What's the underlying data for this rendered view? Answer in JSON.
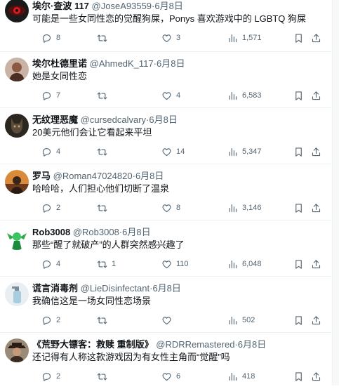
{
  "tweets": [
    {
      "name": "埃尔·查波 117",
      "handle": "@JoseA93559",
      "dot": "·",
      "time": "6月8日",
      "text": "可能是一些女同性恋的觉醒狗屎，Ponys 喜欢游戏中的 LGBTQ 狗屎",
      "replies": "8",
      "retweets": "",
      "likes": "3",
      "views": "1,571",
      "avatar": "red-eye-avatar"
    },
    {
      "name": "埃尔杜德里诺",
      "handle": "@AhmedK_117",
      "dot": "·",
      "time": "6月8日",
      "text": "她是女同性恋",
      "replies": "7",
      "retweets": "",
      "likes": "4",
      "views": "6,583",
      "avatar": "portrait-avatar"
    },
    {
      "name": "无纹理恶魔",
      "handle": "@cursedcalvary",
      "dot": "·",
      "time": "6月8日",
      "text": "20美元他们会让它看起来平坦",
      "replies": "4",
      "retweets": "",
      "likes": "14",
      "views": "5,347",
      "avatar": "dark-figure-avatar"
    },
    {
      "name": "罗马",
      "handle": "@Roman47024820",
      "dot": "·",
      "time": "6月8日",
      "text": "哈哈哈，人们担心他们切断了温泉",
      "replies": "2",
      "retweets": "",
      "likes": "8",
      "views": "3,146",
      "avatar": "sunset-portrait-avatar"
    },
    {
      "name": "Rob3008",
      "handle": "@Rob3008",
      "dot": "·",
      "time": "6月8日",
      "text": "那些“醒了就破产”的人群突然感兴趣了",
      "replies": "4",
      "retweets": "1",
      "likes": "110",
      "views": "6,048",
      "avatar": "green-character-avatar"
    },
    {
      "name": "谎言消毒剂",
      "handle": "@LieDisinfectant",
      "dot": "·",
      "time": "6月8日",
      "text": "我确信这是一场女同性恋场景",
      "replies": "2",
      "retweets": "",
      "likes": "",
      "views": "502",
      "avatar": "spray-bottle-avatar"
    },
    {
      "name": "《荒野大镖客：救赎 重制版》",
      "handle": "@RDRRemastered",
      "dot": "·",
      "time": "6月8日",
      "text": "还记得有人称这款游戏因为有女性主角而“觉醒”吗",
      "replies": "2",
      "retweets": "",
      "likes": "6",
      "views": "418",
      "avatar": "cowboy-avatar"
    }
  ]
}
